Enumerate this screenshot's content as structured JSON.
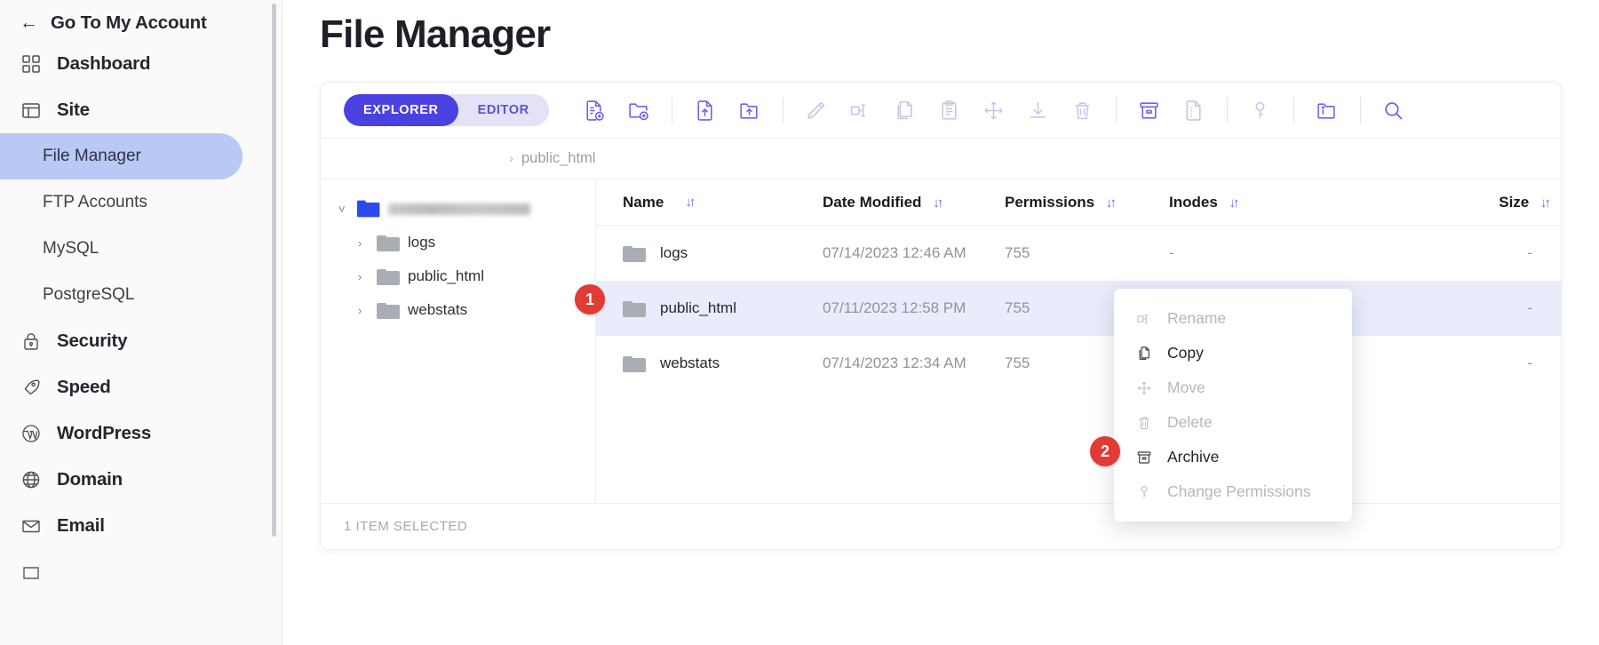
{
  "sidebar": {
    "back": {
      "label": "Go To My Account",
      "icon": "arrow-left-icon"
    },
    "items": [
      {
        "label": "Dashboard",
        "icon": "grid-icon",
        "type": "top"
      },
      {
        "label": "Site",
        "icon": "window-icon",
        "type": "top"
      },
      {
        "label": "File Manager",
        "type": "sub",
        "active": true
      },
      {
        "label": "FTP Accounts",
        "type": "sub",
        "active": false
      },
      {
        "label": "MySQL",
        "type": "sub",
        "active": false
      },
      {
        "label": "PostgreSQL",
        "type": "sub",
        "active": false
      },
      {
        "label": "Security",
        "icon": "lock-icon",
        "type": "top"
      },
      {
        "label": "Speed",
        "icon": "rocket-icon",
        "type": "top"
      },
      {
        "label": "WordPress",
        "icon": "wordpress-icon",
        "type": "top"
      },
      {
        "label": "Domain",
        "icon": "globe-icon",
        "type": "top"
      },
      {
        "label": "Email",
        "icon": "envelope-icon",
        "type": "top"
      }
    ]
  },
  "page": {
    "title": "File Manager"
  },
  "toolbar": {
    "tabs": [
      {
        "label": "EXPLORER",
        "active": true
      },
      {
        "label": "EDITOR",
        "active": false
      }
    ],
    "buttons": [
      {
        "name": "new-file-icon",
        "enabled": true
      },
      {
        "name": "new-folder-icon",
        "enabled": true
      },
      {
        "name": "upload-file-icon",
        "enabled": true
      },
      {
        "name": "upload-folder-icon",
        "enabled": true
      },
      {
        "name": "edit-pencil-icon",
        "enabled": false
      },
      {
        "name": "rename-icon",
        "enabled": false
      },
      {
        "name": "copy-icon",
        "enabled": false
      },
      {
        "name": "paste-icon",
        "enabled": false
      },
      {
        "name": "move-icon",
        "enabled": false
      },
      {
        "name": "download-icon",
        "enabled": false
      },
      {
        "name": "delete-trash-icon",
        "enabled": false
      },
      {
        "name": "archive-icon",
        "enabled": true
      },
      {
        "name": "extract-icon",
        "enabled": false
      },
      {
        "name": "change-permissions-key-icon",
        "enabled": false
      },
      {
        "name": "folder-info-icon",
        "enabled": true
      },
      {
        "name": "search-icon",
        "enabled": true
      }
    ]
  },
  "breadcrumb": {
    "chevron": "›",
    "path": "public_html"
  },
  "tree": {
    "root": {
      "label": "",
      "redacted": true,
      "expanded": true
    },
    "children": [
      {
        "label": "logs"
      },
      {
        "label": "public_html"
      },
      {
        "label": "webstats"
      }
    ]
  },
  "table": {
    "columns": [
      "Name",
      "Date Modified",
      "Permissions",
      "Inodes",
      "Size"
    ],
    "sort_glyph": "↓↑",
    "rows": [
      {
        "name": "logs",
        "date": "07/14/2023 12:46 AM",
        "permissions": "755",
        "inodes": "-",
        "size": "-",
        "selected": false
      },
      {
        "name": "public_html",
        "date": "07/11/2023 12:58 PM",
        "permissions": "755",
        "inodes": "-",
        "size": "-",
        "selected": true
      },
      {
        "name": "webstats",
        "date": "07/14/2023 12:34 AM",
        "permissions": "755",
        "inodes": "",
        "size": "-",
        "selected": false
      }
    ]
  },
  "status": {
    "text": "1 ITEM SELECTED"
  },
  "context_menu": {
    "items": [
      {
        "label": "Rename",
        "icon": "rename-icon",
        "enabled": false
      },
      {
        "label": "Copy",
        "icon": "copy-icon",
        "enabled": true
      },
      {
        "label": "Move",
        "icon": "move-icon",
        "enabled": false
      },
      {
        "label": "Delete",
        "icon": "delete-trash-icon",
        "enabled": false
      },
      {
        "label": "Archive",
        "icon": "archive-icon",
        "enabled": true
      },
      {
        "label": "Change Permissions",
        "icon": "key-icon",
        "enabled": false
      }
    ]
  },
  "annotations": [
    {
      "number": "1",
      "target": "public_html-row"
    },
    {
      "number": "2",
      "target": "archive-menu-item"
    }
  ],
  "colors": {
    "accent": "#4b41e0",
    "accent_soft": "#e3e2f7",
    "selection": "#e9edfb",
    "sidebar_active": "#b9c9f5",
    "badge": "#e13b35",
    "icon_idle": "#c6c6ea",
    "icon_active": "#6b63e8"
  }
}
